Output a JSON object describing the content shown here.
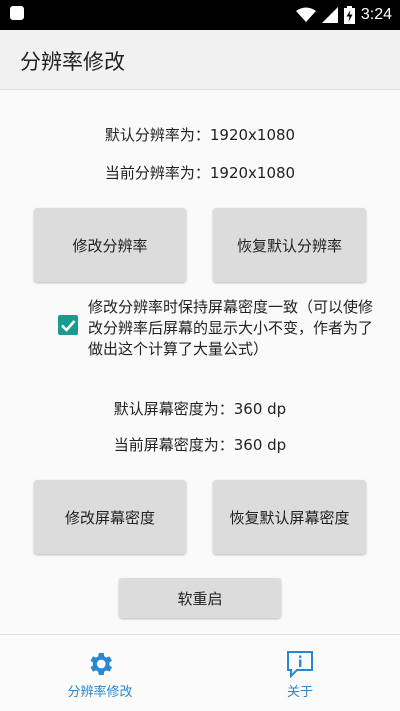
{
  "status_bar": {
    "time": "3:24"
  },
  "app_bar": {
    "title": "分辨率修改"
  },
  "resolution": {
    "default_label": "默认分辨率为：1920x1080",
    "current_label": "当前分辨率为：1920x1080",
    "modify_button": "修改分辨率",
    "restore_button": "恢复默认分辨率"
  },
  "density_option": {
    "checked": true,
    "text": "修改分辨率时保持屏幕密度一致（可以使修改分辨率后屏幕的显示大小不变，作者为了做出这个计算了大量公式）"
  },
  "density": {
    "default_label": "默认屏幕密度为：360 dp",
    "current_label": "当前屏幕密度为：360 dp",
    "modify_button": "修改屏幕密度",
    "restore_button": "恢复默认屏幕密度"
  },
  "soft_reboot_button": "软重启",
  "bottom_nav": {
    "items": [
      {
        "label": "分辨率修改",
        "icon": "gear-icon"
      },
      {
        "label": "关于",
        "icon": "info-icon"
      }
    ]
  },
  "colors": {
    "accent": "#1a9b90",
    "nav_active": "#2a88d1"
  }
}
